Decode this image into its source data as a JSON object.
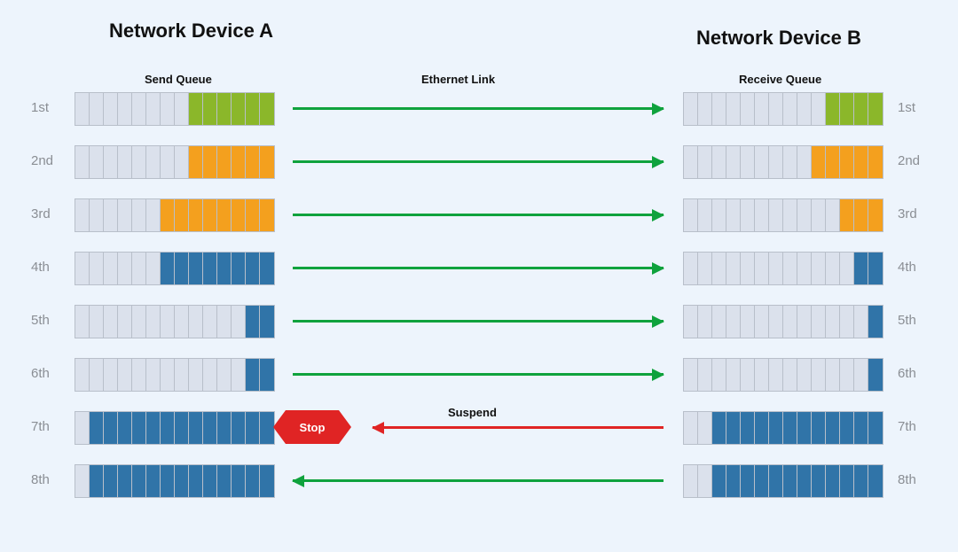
{
  "titles": {
    "left": "Network Device A",
    "right": "Network Device B"
  },
  "subtitles": {
    "send": "Send Queue",
    "link": "Ethernet Link",
    "receive": "Receive Queue"
  },
  "stop_label": "Stop",
  "suspend_label": "Suspend",
  "queue_cells": 14,
  "colors": {
    "empty": "#dbe1ec",
    "green": "#8bb72a",
    "orange": "#f4a01e",
    "blue": "#3074a8",
    "arrow_green": "#0fa23d",
    "arrow_red": "#e02424"
  },
  "rows": [
    {
      "label": "1st",
      "left_fill": 6,
      "left_color": "green",
      "right_fill": 4,
      "right_color": "green",
      "arrow": "right",
      "arrow_color": "g"
    },
    {
      "label": "2nd",
      "left_fill": 6,
      "left_color": "orange",
      "right_fill": 5,
      "right_color": "orange",
      "arrow": "right",
      "arrow_color": "g"
    },
    {
      "label": "3rd",
      "left_fill": 8,
      "left_color": "orange",
      "right_fill": 3,
      "right_color": "orange",
      "arrow": "right",
      "arrow_color": "g"
    },
    {
      "label": "4th",
      "left_fill": 8,
      "left_color": "blue",
      "right_fill": 2,
      "right_color": "blue",
      "arrow": "right",
      "arrow_color": "g"
    },
    {
      "label": "5th",
      "left_fill": 2,
      "left_color": "blue",
      "right_fill": 1,
      "right_color": "blue",
      "arrow": "right",
      "arrow_color": "g"
    },
    {
      "label": "6th",
      "left_fill": 2,
      "left_color": "blue",
      "right_fill": 1,
      "right_color": "blue",
      "arrow": "right",
      "arrow_color": "g"
    },
    {
      "label": "7th",
      "left_fill": 13,
      "left_color": "blue",
      "right_fill": 12,
      "right_color": "blue",
      "arrow": "left",
      "arrow_color": "r",
      "stop": true,
      "suspend": true
    },
    {
      "label": "8th",
      "left_fill": 13,
      "left_color": "blue",
      "right_fill": 12,
      "right_color": "blue",
      "arrow": "left",
      "arrow_color": "g"
    }
  ],
  "chart_data": {
    "type": "table",
    "description": "Pause/Flow-control diagram showing send queue fill on Device A and receive queue fill on Device B over 8 time steps across an Ethernet link. Rows 1-6 transmit left-to-right; row 7 triggers a Suspend/Stop (pause frame) right-to-left; row 8 is a green left arrow.",
    "columns": [
      "step",
      "send_fill_cells",
      "send_color",
      "recv_fill_cells",
      "recv_color",
      "direction",
      "signal"
    ],
    "rows": [
      [
        "1st",
        6,
        "green",
        4,
        "green",
        "A→B",
        ""
      ],
      [
        "2nd",
        6,
        "orange",
        5,
        "orange",
        "A→B",
        ""
      ],
      [
        "3rd",
        8,
        "orange",
        3,
        "orange",
        "A→B",
        ""
      ],
      [
        "4th",
        8,
        "blue",
        2,
        "blue",
        "A→B",
        ""
      ],
      [
        "5th",
        2,
        "blue",
        1,
        "blue",
        "A→B",
        ""
      ],
      [
        "6th",
        2,
        "blue",
        1,
        "blue",
        "A→B",
        ""
      ],
      [
        "7th",
        13,
        "blue",
        12,
        "blue",
        "B→A",
        "Suspend / Stop"
      ],
      [
        "8th",
        13,
        "blue",
        12,
        "blue",
        "B→A",
        ""
      ]
    ],
    "queue_capacity_cells": 14
  }
}
